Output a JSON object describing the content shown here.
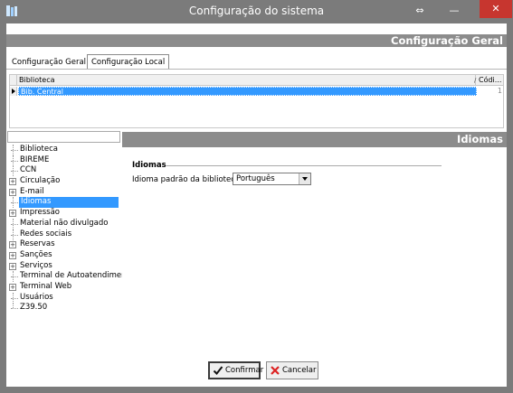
{
  "window": {
    "title": "Configuração do sistema",
    "restore_glyph": "⇔",
    "minimize_glyph": "—",
    "close_glyph": "✕"
  },
  "header": {
    "banner": "Configuração Geral"
  },
  "tabs": [
    {
      "label": "Configuração Geral",
      "active": false
    },
    {
      "label": "Configuração Local",
      "active": true
    }
  ],
  "grid": {
    "columns": [
      "Biblioteca",
      "Códi..."
    ],
    "sort_glyph": "/",
    "rows": [
      {
        "biblioteca": "Bib. Central",
        "codigo": "1",
        "selected": true
      }
    ]
  },
  "tree": {
    "items": [
      {
        "label": "Biblioteca",
        "expandable": false,
        "selected": false
      },
      {
        "label": "BIREME",
        "expandable": false,
        "selected": false
      },
      {
        "label": "CCN",
        "expandable": false,
        "selected": false
      },
      {
        "label": "Circulação",
        "expandable": true,
        "selected": false
      },
      {
        "label": "E-mail",
        "expandable": true,
        "selected": false
      },
      {
        "label": "Idiomas",
        "expandable": false,
        "selected": true
      },
      {
        "label": "Impressão",
        "expandable": true,
        "selected": false
      },
      {
        "label": "Material não divulgado",
        "expandable": false,
        "selected": false
      },
      {
        "label": "Redes sociais",
        "expandable": false,
        "selected": false
      },
      {
        "label": "Reservas",
        "expandable": true,
        "selected": false
      },
      {
        "label": "Sanções",
        "expandable": true,
        "selected": false
      },
      {
        "label": "Serviços",
        "expandable": true,
        "selected": false
      },
      {
        "label": "Terminal de Autoatendiment",
        "expandable": false,
        "selected": false
      },
      {
        "label": "Terminal Web",
        "expandable": true,
        "selected": false
      },
      {
        "label": "Usuários",
        "expandable": false,
        "selected": false
      },
      {
        "label": "Z39.50",
        "expandable": false,
        "selected": false
      }
    ]
  },
  "section": {
    "banner": "Idiomas",
    "group_title": "Idiomas",
    "field_label": "Idioma padrão da biblioteca",
    "field_value": "Português"
  },
  "buttons": {
    "confirm": "Confirmar",
    "cancel": "Cancelar"
  },
  "colors": {
    "selection": "#3399ff",
    "banner": "#8c8c8c",
    "chrome": "#7b7b7b",
    "close": "#c7362f"
  }
}
